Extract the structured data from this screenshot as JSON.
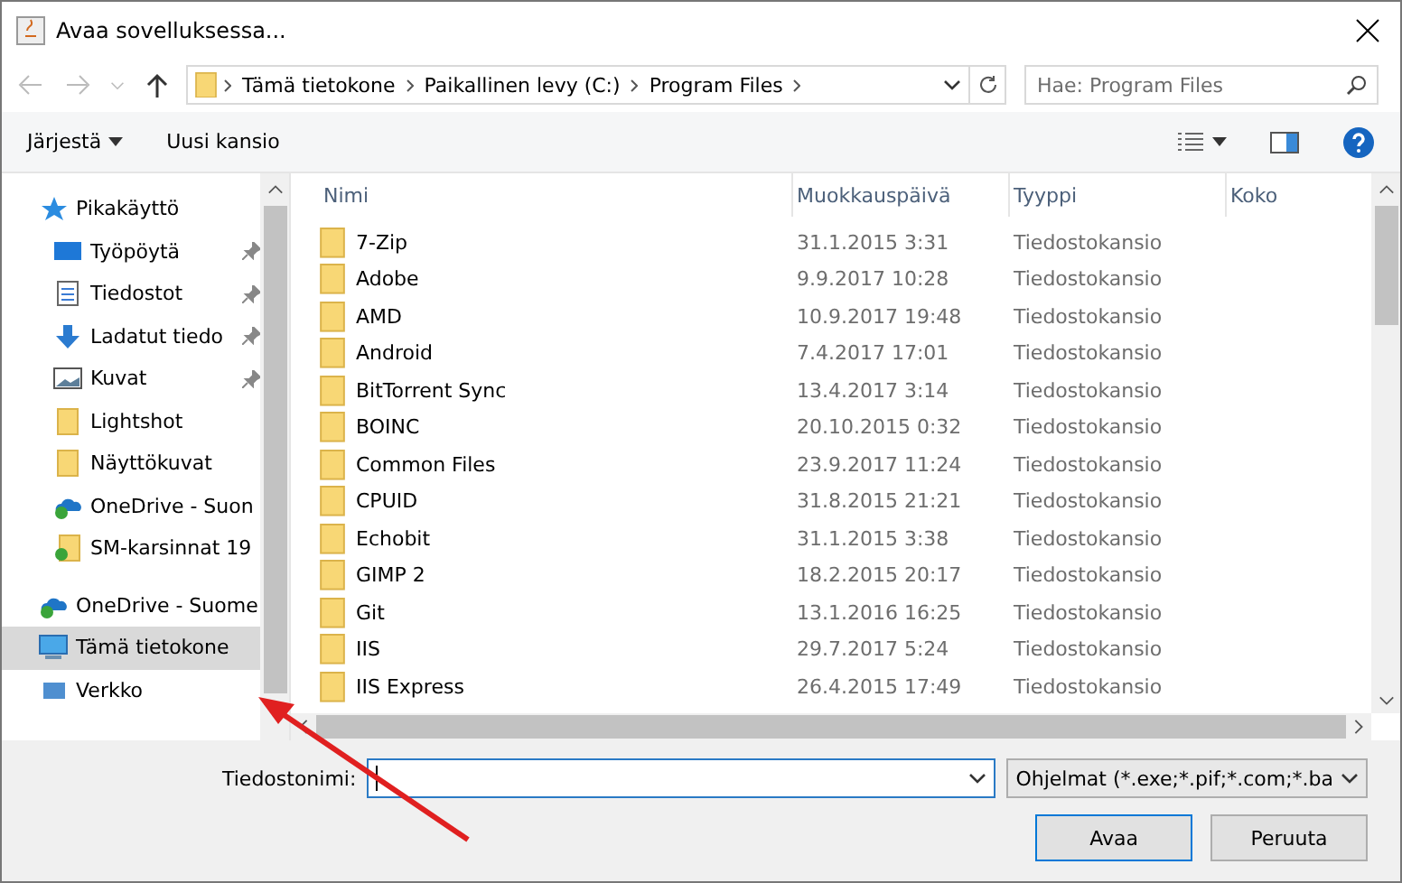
{
  "window": {
    "title": "Avaa sovelluksessa..."
  },
  "address": {
    "segments": [
      "Tämä tietokone",
      "Paikallinen levy (C:)",
      "Program Files"
    ]
  },
  "search": {
    "placeholder": "Hae: Program Files"
  },
  "toolbar": {
    "organize": "Järjestä",
    "new_folder": "Uusi kansio"
  },
  "sidebar": {
    "items": [
      {
        "label": "Pikakäyttö",
        "kind": "star",
        "pinned": false,
        "selected": false,
        "children": [
          {
            "label": "Työpöytä",
            "kind": "desktop",
            "pinned": true,
            "selected": false
          },
          {
            "label": "Tiedostot",
            "kind": "document",
            "pinned": true,
            "selected": false
          },
          {
            "label": "Ladatut tiedo",
            "kind": "download",
            "pinned": true,
            "selected": false
          },
          {
            "label": "Kuvat",
            "kind": "pictures",
            "pinned": true,
            "selected": false
          },
          {
            "label": "Lightshot",
            "kind": "folder",
            "pinned": false,
            "selected": false
          },
          {
            "label": "Näyttökuvat",
            "kind": "folder",
            "pinned": false,
            "selected": false
          },
          {
            "label": "OneDrive - Suon",
            "kind": "cloud",
            "pinned": false,
            "selected": false
          },
          {
            "label": "SM-karsinnat 19",
            "kind": "syncfolder",
            "pinned": false,
            "selected": false
          }
        ]
      },
      {
        "label": "OneDrive - Suome",
        "kind": "cloud",
        "pinned": false,
        "selected": false
      },
      {
        "label": "Tämä tietokone",
        "kind": "computer",
        "pinned": false,
        "selected": true
      },
      {
        "label": "Verkko",
        "kind": "network",
        "pinned": false,
        "selected": false
      }
    ]
  },
  "table": {
    "columns": [
      "Nimi",
      "Muokkauspäivä",
      "Tyyppi",
      "Koko"
    ],
    "rows": [
      [
        "7-Zip",
        "31.1.2015 3:31",
        "Tiedostokansio"
      ],
      [
        "Adobe",
        "9.9.2017 10:28",
        "Tiedostokansio"
      ],
      [
        "AMD",
        "10.9.2017 19:48",
        "Tiedostokansio"
      ],
      [
        "Android",
        "7.4.2017 17:01",
        "Tiedostokansio"
      ],
      [
        "BitTorrent Sync",
        "13.4.2017 3:14",
        "Tiedostokansio"
      ],
      [
        "BOINC",
        "20.10.2015 0:32",
        "Tiedostokansio"
      ],
      [
        "Common Files",
        "23.9.2017 11:24",
        "Tiedostokansio"
      ],
      [
        "CPUID",
        "31.8.2015 21:21",
        "Tiedostokansio"
      ],
      [
        "Echobit",
        "31.1.2015 3:38",
        "Tiedostokansio"
      ],
      [
        "GIMP 2",
        "18.2.2015 20:17",
        "Tiedostokansio"
      ],
      [
        "Git",
        "13.1.2016 16:25",
        "Tiedostokansio"
      ],
      [
        "IIS",
        "29.7.2017 5:24",
        "Tiedostokansio"
      ],
      [
        "IIS Express",
        "26.4.2015 17:49",
        "Tiedostokansio"
      ]
    ]
  },
  "footer": {
    "filename_label": "Tiedostonimi:",
    "filter": "Ohjelmat (*.exe;*.pif;*.com;*.ba",
    "open": "Avaa",
    "cancel": "Peruuta"
  }
}
